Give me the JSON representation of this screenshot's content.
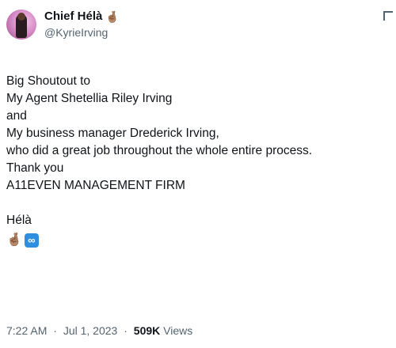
{
  "author": {
    "display_name": "Chief Hélà",
    "name_emoji": "🤞🏽",
    "handle": "@KyrieIrving"
  },
  "tweet": {
    "lines": [
      "Big Shoutout to",
      "My Agent Shetellia Riley Irving",
      "and",
      "My business manager Drederick Irving,",
      "who did a great job throughout the whole entire process.",
      "Thank you",
      "A11EVEN MANAGEMENT FIRM"
    ],
    "signature": "Hélà",
    "signature_emojis": [
      "🤞🏽",
      "∞"
    ]
  },
  "meta": {
    "time": "7:22 AM",
    "separator": "·",
    "date": "Jul 1, 2023",
    "views_count": "509K",
    "views_label": "Views"
  },
  "icons": {
    "more": "chevron-icon",
    "hand": "crossed-fingers-emoji",
    "infinity": "infinity-emoji"
  },
  "colors": {
    "text": "#0f1419",
    "secondary": "#536471",
    "infinity_bg": "#2e8fe0"
  }
}
